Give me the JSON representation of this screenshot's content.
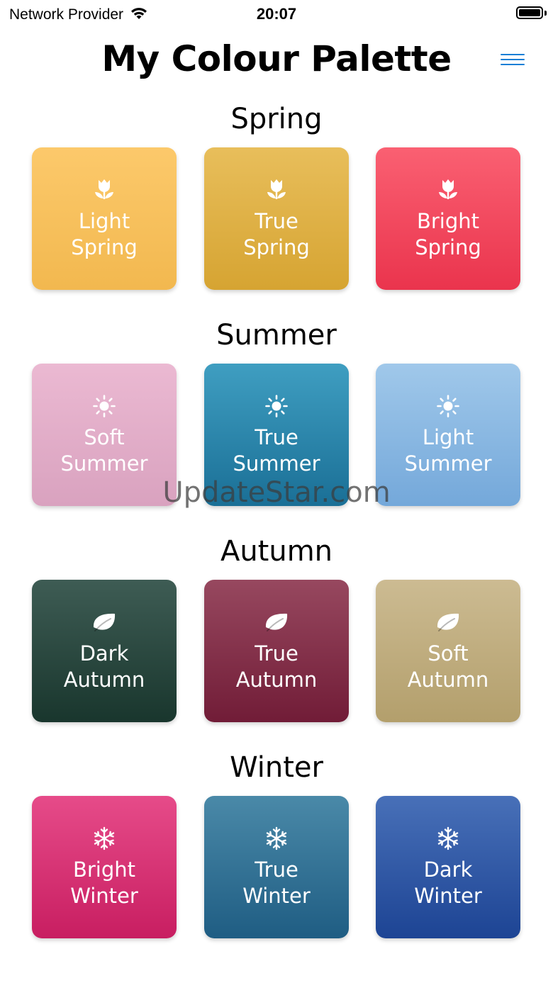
{
  "status_bar": {
    "carrier": "Network Provider",
    "time": "20:07",
    "wifi_icon": "wifi-icon",
    "battery_icon": "battery-icon"
  },
  "header": {
    "title": "My Colour Palette",
    "menu_icon": "hamburger-menu-icon",
    "accent_color": "#1a7fd6"
  },
  "sections": [
    {
      "title": "Spring",
      "icon": "tulip-icon",
      "cards": [
        {
          "line1": "Light",
          "line2": "Spring",
          "color_top": "#fcc96b",
          "color_bottom": "#f2b84f"
        },
        {
          "line1": "True",
          "line2": "Spring",
          "color_top": "#e8be5b",
          "color_bottom": "#d6a432"
        },
        {
          "line1": "Bright",
          "line2": "Spring",
          "color_top": "#fa6072",
          "color_bottom": "#ea344d"
        }
      ]
    },
    {
      "title": "Summer",
      "icon": "sun-icon",
      "cards": [
        {
          "line1": "Soft",
          "line2": "Summer",
          "color_top": "#ebb9d2",
          "color_bottom": "#d9a2bf"
        },
        {
          "line1": "True",
          "line2": "Summer",
          "color_top": "#3f9ec1",
          "color_bottom": "#1a6f96"
        },
        {
          "line1": "Light",
          "line2": "Summer",
          "color_top": "#a0c8ea",
          "color_bottom": "#74a8da"
        }
      ]
    },
    {
      "title": "Autumn",
      "icon": "leaf-icon",
      "cards": [
        {
          "line1": "Dark",
          "line2": "Autumn",
          "color_top": "#3e5c54",
          "color_bottom": "#19362d"
        },
        {
          "line1": "True",
          "line2": "Autumn",
          "color_top": "#97485f",
          "color_bottom": "#711c37"
        },
        {
          "line1": "Soft",
          "line2": "Autumn",
          "color_top": "#ccbb92",
          "color_bottom": "#b39f6c"
        }
      ]
    },
    {
      "title": "Winter",
      "icon": "snowflake-icon",
      "cards": [
        {
          "line1": "Bright",
          "line2": "Winter",
          "color_top": "#e64b89",
          "color_bottom": "#c81e61"
        },
        {
          "line1": "True",
          "line2": "Winter",
          "color_top": "#4a89a8",
          "color_bottom": "#1f5d83"
        },
        {
          "line1": "Dark",
          "line2": "Winter",
          "color_top": "#4870b8",
          "color_bottom": "#1d4494"
        }
      ]
    }
  ],
  "watermark": "UpdateStar.com"
}
